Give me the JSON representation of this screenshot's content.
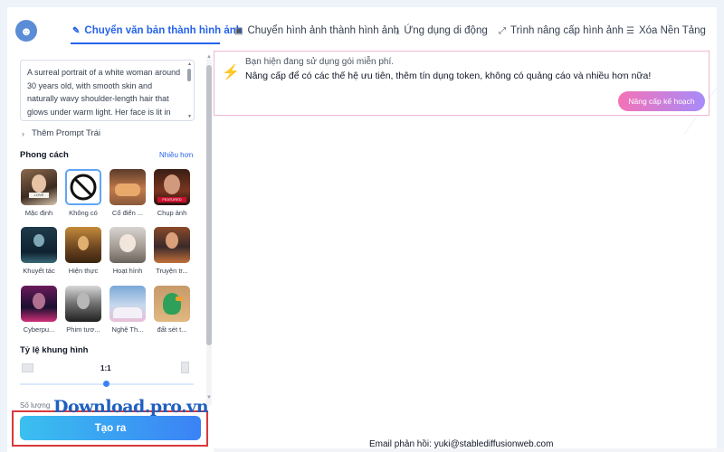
{
  "header": {
    "tabs": [
      {
        "label": "Chuyển văn bản thành hình ảnh",
        "icon": "magic-wand-icon",
        "active": true
      },
      {
        "label": "Chuyển hình ảnh thành hình ảnh",
        "icon": "image-icon",
        "active": false
      },
      {
        "label": "Ứng dụng di động",
        "icon": "download-icon",
        "active": false
      },
      {
        "label": "Trình nâng cấp hình ảnh",
        "icon": "expand-icon",
        "active": false
      },
      {
        "label": "Xóa Nền Tảng",
        "icon": "database-icon",
        "active": false
      }
    ]
  },
  "sidebar": {
    "prompt": "A surreal portrait of a white woman around 30 years old, with smooth skin and naturally wavy shoulder-length hair that glows under warm light. Her face is lit in",
    "add_prompt_label": "Thêm Prompt Trái",
    "style_label": "Phong cách",
    "style_more": "Nhiều hơn",
    "styles": [
      {
        "label": "Mặc định"
      },
      {
        "label": "Không có"
      },
      {
        "label": "Cổ điển ..."
      },
      {
        "label": "Chụp ảnh"
      },
      {
        "label": "Khuyết tác"
      },
      {
        "label": "Hiện thực"
      },
      {
        "label": "Hoạt hình"
      },
      {
        "label": "Truyện tr..."
      },
      {
        "label": "Cyberpu..."
      },
      {
        "label": "Phim tươ..."
      },
      {
        "label": "Nghệ Th..."
      },
      {
        "label": "đất sét t..."
      }
    ],
    "ratio_label": "Tỷ lệ khung hình",
    "ratio_value": "1:1",
    "count_label": "Số lượng",
    "generate_label": "Tạo ra"
  },
  "watermark": "Download.pro.vn",
  "notice": {
    "line1": "Bạn hiện đang sử dụng gói miễn phí.",
    "line2": "Nâng cấp để có các thế hệ ưu tiên, thêm tín dụng token, không có quảng cáo và nhiều hơn nữa!",
    "upgrade_label": "Nâng cấp kế hoạch"
  },
  "footer": {
    "feedback": "Email phản hồi: yuki@stablediffusionweb.com"
  }
}
